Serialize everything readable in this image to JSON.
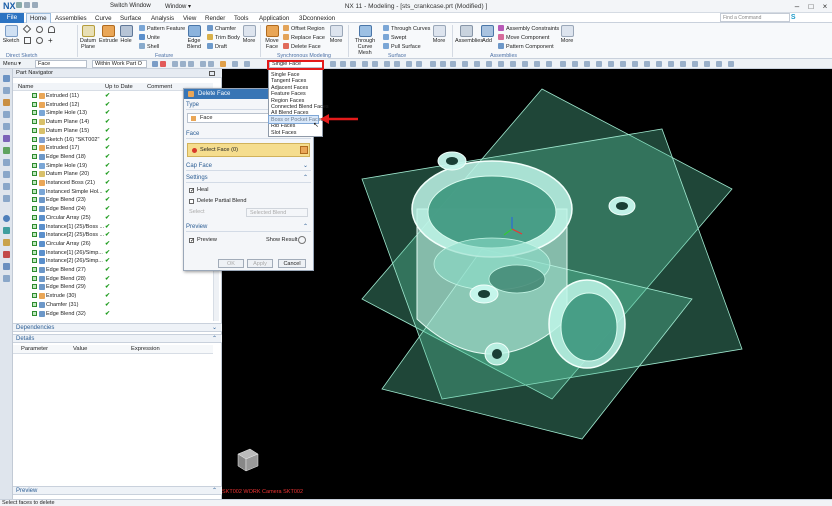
{
  "app": {
    "logo": "NX",
    "title": "NX 11 - Modeling - [sts_crankcase.prt (Modified) ]",
    "switch_window": "Switch Window",
    "window_menu": "Window ▾",
    "brand": "SIEMENS",
    "search_placeholder": "Find a Command"
  },
  "menu": [
    "File",
    "Home",
    "Assemblies",
    "Curve",
    "Surface",
    "Analysis",
    "View",
    "Render",
    "Tools",
    "Application",
    "3Dconnexion"
  ],
  "ribbon": {
    "sketch": "Sketch",
    "direct_sketch": "Direct Sketch",
    "datum_plane": "Datum Plane",
    "extrude": "Extrude",
    "hole": "Hole",
    "pattern_feature": "Pattern Feature",
    "unite": "Unite",
    "shell": "Shell",
    "edge_blend": "Edge Blend",
    "chamfer": "Chamfer",
    "trim_body": "Trim Body",
    "draft": "Draft",
    "more1": "More",
    "feature_group": "Feature",
    "move_face": "Move Face",
    "offset_region": "Offset Region",
    "replace_face": "Replace Face",
    "delete_face": "Delete Face",
    "more2": "More",
    "sync_group": "Synchronous Modeling",
    "through_curve_mesh": "Through Curve Mesh",
    "through_curves": "Through Curves",
    "swept": "Swept",
    "pull_surface": "Pull Surface",
    "more3": "More",
    "surface_group": "Surface",
    "assembly_btn": "Assemblies",
    "add": "Add",
    "assembly_constraints": "Assembly Constraints",
    "move_component": "Move Component",
    "pattern_component": "Pattern Component",
    "more4": "More",
    "assemblies_group": "Assemblies"
  },
  "toolbar": {
    "menu": "Menu ▾",
    "filter": "Face",
    "scope": "Within Work Part O",
    "face_rule": "Single Face"
  },
  "dropdown": [
    "Single Face",
    "Tangent Faces",
    "Adjacent Faces",
    "Feature Faces",
    "Region Faces",
    "Connected Blend Faces",
    "All Blend Faces",
    "Boss or Pocket Faces",
    "Rib Faces",
    "Slot Faces"
  ],
  "navigator": {
    "title": "Part Navigator",
    "col_name": "Name",
    "col_uptodate": "Up to Date",
    "col_comment": "Comment",
    "items": [
      "Extruded (11)",
      "Extruded (12)",
      "Simple Hole (13)",
      "Datum Plane (14)",
      "Datum Plane (15)",
      "Sketch (16) \"SKT002\"",
      "Extruded (17)",
      "Edge Blend (18)",
      "Simple Hole (19)",
      "Datum Plane (20)",
      "Instanced Boss (21)",
      "Instanced Simple Hol...",
      "Edge Blend (23)",
      "Edge Blend (24)",
      "Circular Array (25)",
      "Instance[1] (25)/Boss ...",
      "Instance[2] (25)/Boss ...",
      "Circular Array (26)",
      "Instance[1] (26)/Simp...",
      "Instance[2] (26)/Simp...",
      "Edge Blend (27)",
      "Edge Blend (28)",
      "Edge Blend (29)",
      "Extrude (30)",
      "Chamfer (31)",
      "Edge Blend (32)"
    ],
    "dependencies": "Dependencies",
    "details": "Details",
    "param": "Parameter",
    "value": "Value",
    "expression": "Expression",
    "preview": "Preview"
  },
  "dialog": {
    "title": "Delete Face",
    "type_section": "Type",
    "type_value": "Face",
    "face_section": "Face",
    "select_face": "Select Face (0)",
    "cap_face": "Cap Face",
    "settings": "Settings",
    "heal": "Heal",
    "delete_partial_blend": "Delete Partial Blend",
    "select": "Select",
    "selected_blend": "Selected Blend",
    "preview_section": "Preview",
    "preview": "Preview",
    "show_result": "Show Result",
    "ok": "OK",
    "apply": "Apply",
    "cancel": "Cancel"
  },
  "viewport": {
    "label": "SKT002 WORK Camera SKT002"
  },
  "status": "Select faces to delete"
}
